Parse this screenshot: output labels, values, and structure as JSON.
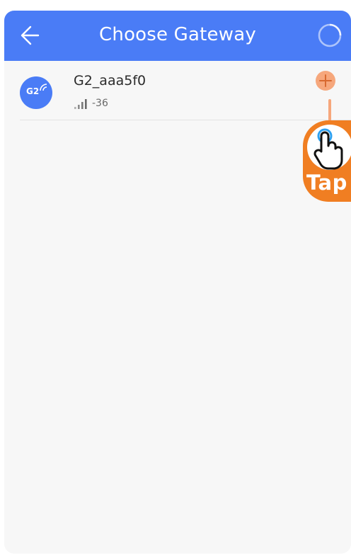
{
  "header": {
    "title": "Choose Gateway",
    "back_icon": "back-arrow-icon",
    "refresh_icon": "refresh-circle-icon"
  },
  "gateways": [
    {
      "name": "G2_aaa5f0",
      "badge": "G2",
      "rssi": "-36",
      "signal_icon": "signal-strength-icon",
      "add_icon": "plus-icon"
    }
  ],
  "hint": {
    "label": "Tap",
    "icon": "tap-hand-icon"
  },
  "colors": {
    "header_bg": "#4a7cf6",
    "avatar_bg": "#4a7cf6",
    "add_button": "#f6a77c",
    "hint_orange": "#f07e22",
    "background": "#f7f7f7"
  }
}
